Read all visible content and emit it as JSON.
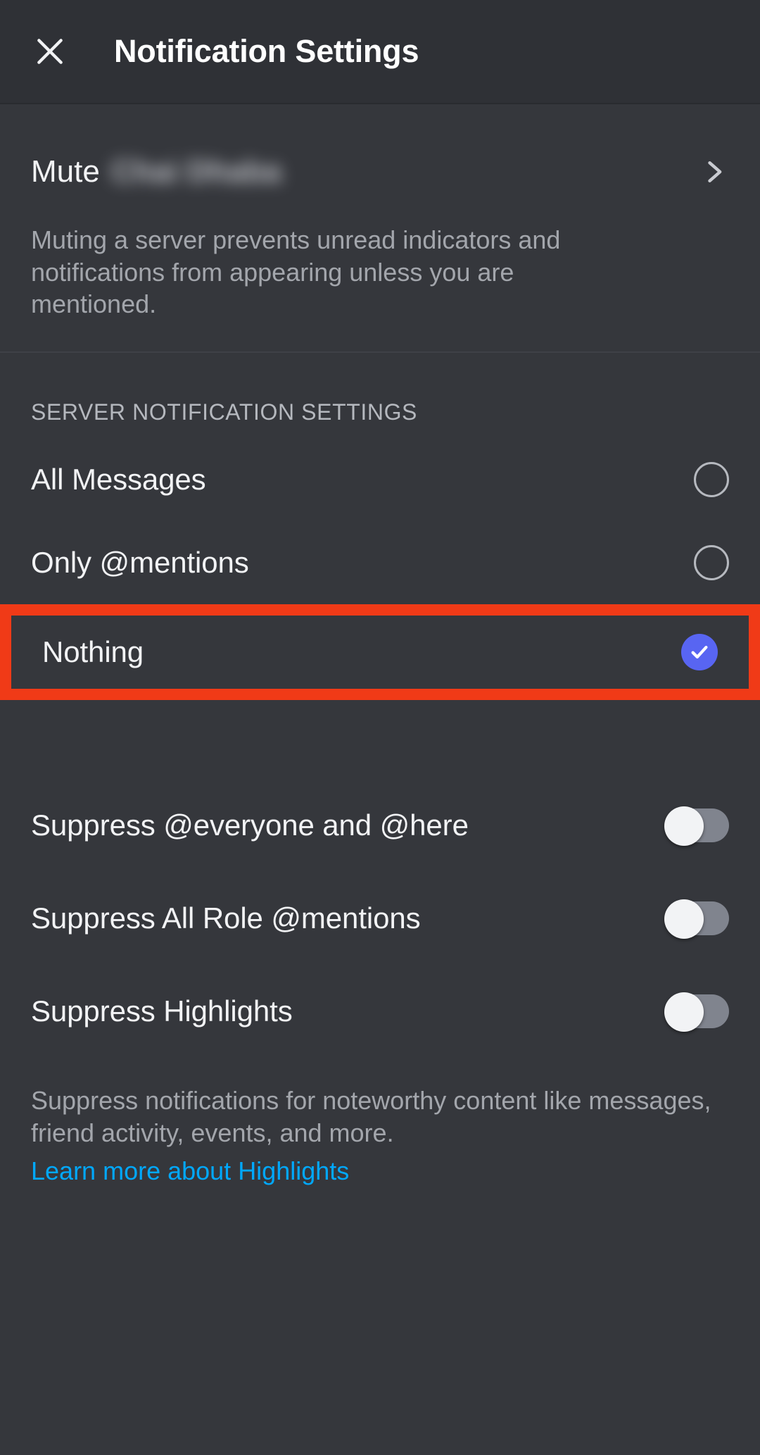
{
  "header": {
    "title": "Notification Settings",
    "close_icon": "close-icon"
  },
  "mute": {
    "label": "Mute",
    "server_name": "Chai Dhaba",
    "chevron_icon": "chevron-right-icon",
    "description": "Muting a server prevents unread indicators and notifications from appearing unless you are mentioned."
  },
  "server_notification_settings": {
    "section_title": "SERVER NOTIFICATION SETTINGS",
    "options": [
      {
        "label": "All Messages",
        "selected": false
      },
      {
        "label": "Only @mentions",
        "selected": false
      },
      {
        "label": "Nothing",
        "selected": true,
        "highlighted": true
      }
    ]
  },
  "toggles": [
    {
      "label": "Suppress @everyone and @here",
      "state": "off"
    },
    {
      "label": "Suppress All Role @mentions",
      "state": "off"
    },
    {
      "label": "Suppress Highlights",
      "state": "off"
    }
  ],
  "footer": {
    "description": "Suppress notifications for noteworthy content like messages, friend activity, events, and more.",
    "link_label": "Learn more about Highlights"
  },
  "colors": {
    "background": "#35373C",
    "header_background": "#2F3136",
    "accent_blurple": "#5865F2",
    "annotation_red": "#F03A17",
    "link_blue": "#00A8FC",
    "toggle_track_off": "#80848E",
    "muted_text": "#A3A6AC"
  }
}
